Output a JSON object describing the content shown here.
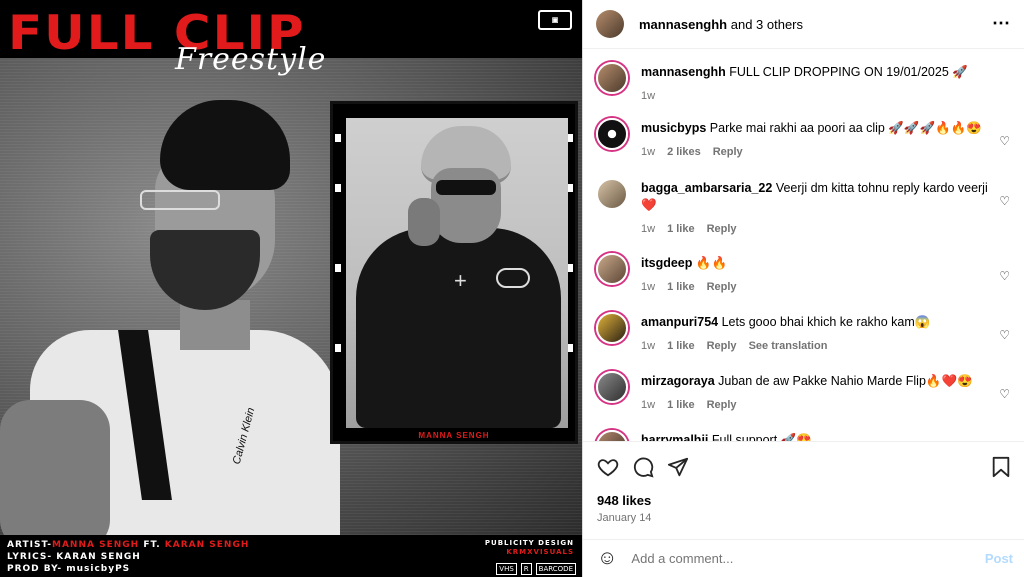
{
  "poster": {
    "title": "FULL CLIP",
    "subtitle": "Freestyle",
    "frame_caption": "MANNA SENGH",
    "credit_artist_label": "ARTIST-",
    "credit_artist": "MANNA SENGH",
    "credit_ft": " FT. ",
    "credit_feat": "KARAN SENGH",
    "credit_lyrics": "LYRICS- KARAN SENGH",
    "credit_prod": "PROD BY- musicbyPS",
    "publicity_label": "PUBLICITY DESIGN",
    "publicity_name": "KRMXVISUALS",
    "shirt_logo": "Calvin Klein",
    "bottom_badges": [
      "VHS",
      "R",
      "BARCODE"
    ]
  },
  "header": {
    "username": "mannasenghh",
    "others": " and 3 others",
    "more_icon": "⋯"
  },
  "comments": [
    {
      "user": "mannasenghh",
      "text": "FULL CLIP DROPPING ON 19/01/2025 🚀",
      "time": "1w",
      "likes": "",
      "reply": "",
      "translate": "",
      "caption": true
    },
    {
      "user": "musicbyps",
      "text": "Parke mai rakhi aa poori aa clip 🚀🚀🚀🔥🔥😍",
      "time": "1w",
      "likes": "2 likes",
      "reply": "Reply",
      "translate": ""
    },
    {
      "user": "bagga_ambarsaria_22",
      "text": "Veerji dm kitta tohnu reply kardo veerji ❤️",
      "time": "1w",
      "likes": "1 like",
      "reply": "Reply",
      "translate": ""
    },
    {
      "user": "itsgdeep",
      "text": "🔥🔥",
      "time": "1w",
      "likes": "1 like",
      "reply": "Reply",
      "translate": ""
    },
    {
      "user": "amanpuri754",
      "text": "Lets gooo bhai khich ke rakho kam😱",
      "time": "1w",
      "likes": "1 like",
      "reply": "Reply",
      "translate": "See translation"
    },
    {
      "user": "mirzagoraya",
      "text": "Juban de aw Pakke Nahio Marde Flip🔥❤️😍",
      "time": "1w",
      "likes": "1 like",
      "reply": "Reply",
      "translate": ""
    },
    {
      "user": "harrymalhii",
      "text": "Full support 🚀😍",
      "time": "",
      "likes": "",
      "reply": "",
      "translate": ""
    }
  ],
  "actions": {
    "likes": "948 likes",
    "date": "January 14"
  },
  "add_comment": {
    "placeholder": "Add a comment...",
    "post_label": "Post"
  }
}
